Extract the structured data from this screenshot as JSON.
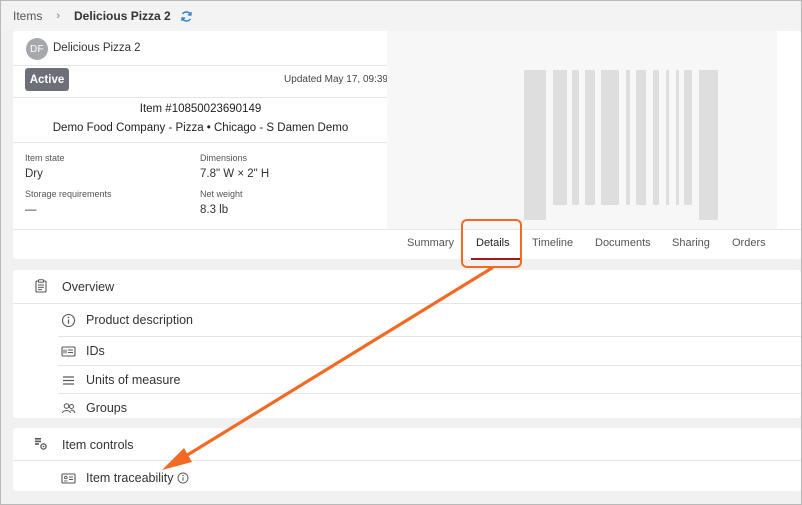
{
  "breadcrumb": {
    "parent": "Items",
    "separator": "›",
    "current": "Delicious Pizza 2"
  },
  "item": {
    "avatar_initials": "DF",
    "name": "Delicious Pizza 2",
    "status": "Active",
    "updated": "Updated May 17, 09:39",
    "number": "Item #10850023690149",
    "company": "Demo Food Company - Pizza • Chicago - S Damen Demo"
  },
  "attributes": {
    "item_state_label": "Item state",
    "item_state_value": "Dry",
    "dimensions_label": "Dimensions",
    "dimensions_value": "7.8\" W × 2\" H",
    "storage_label": "Storage requirements",
    "storage_value": "—",
    "net_weight_label": "Net weight",
    "net_weight_value": "8.3 lb"
  },
  "tabs": [
    "Summary",
    "Details",
    "Timeline",
    "Documents",
    "Sharing",
    "Orders"
  ],
  "active_tab": "Details",
  "overview": {
    "title": "Overview",
    "rows": [
      {
        "label": "Product description",
        "icon": "info-icon"
      },
      {
        "label": "IDs",
        "icon": "id-card-icon"
      },
      {
        "label": "Units of measure",
        "icon": "list-icon"
      },
      {
        "label": "Groups",
        "icon": "users-icon"
      }
    ]
  },
  "controls": {
    "title": "Item controls",
    "rows": [
      {
        "label": "Item traceability",
        "icon": "traceability-icon"
      }
    ]
  },
  "colors": {
    "accent_orange": "#f26a24",
    "tab_underline": "#9b1c1c",
    "badge": "#6d7079"
  }
}
